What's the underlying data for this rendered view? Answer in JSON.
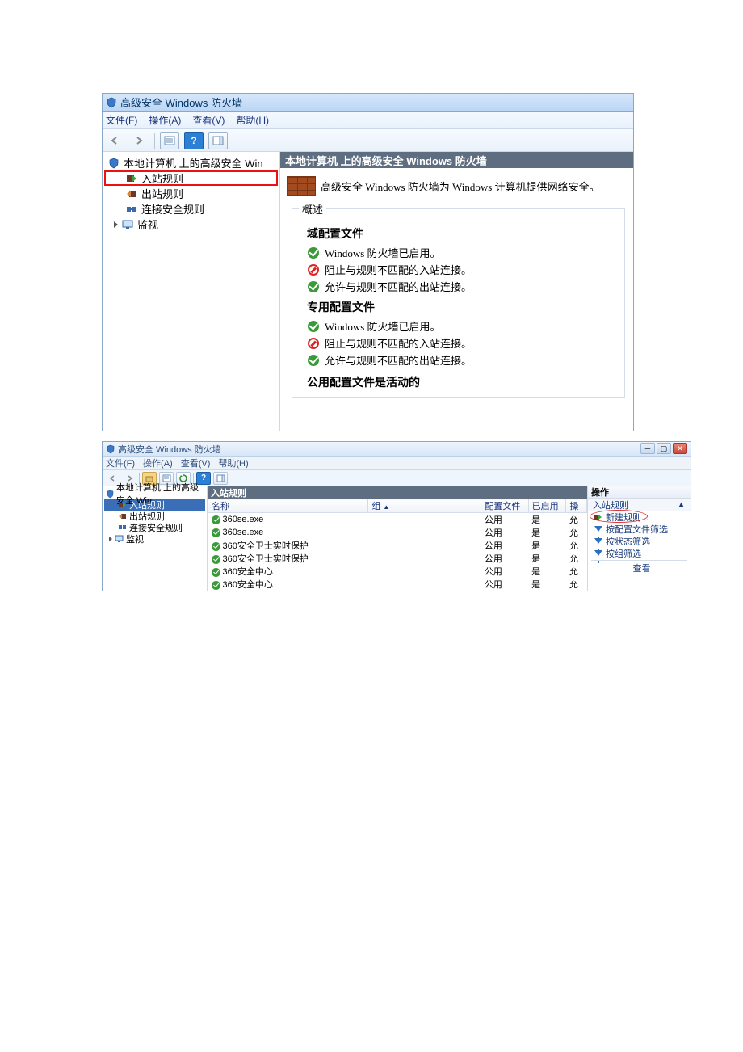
{
  "win1": {
    "title": "高级安全 Windows 防火墙",
    "menu": {
      "file": "文件(F)",
      "action": "操作(A)",
      "view": "查看(V)",
      "help": "帮助(H)"
    },
    "tree": {
      "root": "本地计算机 上的高级安全 Win",
      "inbound": "入站规则",
      "outbound": "出站规则",
      "connsec": "连接安全规则",
      "monitor": "监视"
    },
    "content": {
      "header": "本地计算机 上的高级安全 Windows 防火墙",
      "banner": "高级安全 Windows 防火墙为 Windows 计算机提供网络安全。",
      "overview": "概述",
      "domain": {
        "title": "域配置文件",
        "l1": "Windows 防火墙已启用。",
        "l2": "阻止与规则不匹配的入站连接。",
        "l3": "允许与规则不匹配的出站连接。"
      },
      "private": {
        "title": "专用配置文件",
        "l1": "Windows 防火墙已启用。",
        "l2": "阻止与规则不匹配的入站连接。",
        "l3": "允许与规则不匹配的出站连接。"
      },
      "public_cut": "公用配置文件是活动的"
    }
  },
  "win2": {
    "title": "高级安全 Windows 防火墙",
    "menu": {
      "file": "文件(F)",
      "action": "操作(A)",
      "view": "查看(V)",
      "help": "帮助(H)"
    },
    "tree": {
      "root": "本地计算机 上的高级安全 Win",
      "inbound": "入站规则",
      "outbound": "出站规则",
      "connsec": "连接安全规则",
      "monitor": "监视"
    },
    "mid_header": "入站规则",
    "cols": {
      "name": "名称",
      "group": "组",
      "profile": "配置文件",
      "enabled": "已启用",
      "action": "操"
    },
    "rows": [
      {
        "name": "360se.exe",
        "profile": "公用",
        "enabled": "是",
        "action": "允"
      },
      {
        "name": "360se.exe",
        "profile": "公用",
        "enabled": "是",
        "action": "允"
      },
      {
        "name": "360安全卫士实时保护",
        "profile": "公用",
        "enabled": "是",
        "action": "允"
      },
      {
        "name": "360安全卫士实时保护",
        "profile": "公用",
        "enabled": "是",
        "action": "允"
      },
      {
        "name": "360安全中心",
        "profile": "公用",
        "enabled": "是",
        "action": "允"
      },
      {
        "name": "360安全中心",
        "profile": "公用",
        "enabled": "是",
        "action": "允"
      }
    ],
    "actions": {
      "header": "操作",
      "group": "入站规则",
      "new": "新建规则...",
      "filter_profile": "按配置文件筛选",
      "filter_state": "按状态筛选",
      "filter_group": "按组筛选",
      "view": "查看"
    }
  }
}
